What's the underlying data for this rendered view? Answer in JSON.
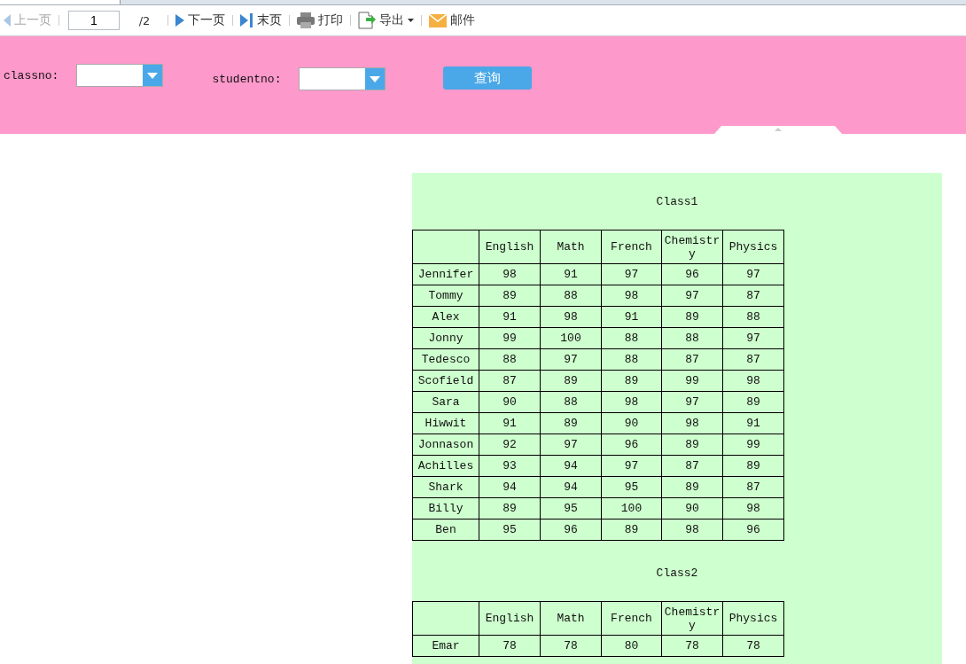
{
  "toolbar": {
    "prev": {
      "label": "上一页",
      "disabled": true
    },
    "page": {
      "value": "1",
      "total": "/2"
    },
    "next": {
      "label": "下一页",
      "disabled": false
    },
    "last": {
      "label": "末页",
      "disabled": false
    },
    "print": "打印",
    "export": "导出",
    "mail": "邮件"
  },
  "filters": [
    {
      "label": "classno:"
    },
    {
      "label": "studentno:"
    }
  ],
  "query_button": "查询",
  "tables": [
    {
      "title": "Class1",
      "columns": [
        "English",
        "Math",
        "French",
        "Chemistry",
        "Physics"
      ],
      "rows": [
        {
          "name": "Jennifer",
          "scores": [
            "98",
            "91",
            "97",
            "96",
            "97"
          ]
        },
        {
          "name": "Tommy",
          "scores": [
            "89",
            "88",
            "98",
            "97",
            "87"
          ]
        },
        {
          "name": "Alex",
          "scores": [
            "91",
            "98",
            "91",
            "89",
            "88"
          ]
        },
        {
          "name": "Jonny",
          "scores": [
            "99",
            "100",
            "88",
            "88",
            "97"
          ]
        },
        {
          "name": "Tedesco",
          "scores": [
            "88",
            "97",
            "88",
            "87",
            "87"
          ]
        },
        {
          "name": "Scofield",
          "scores": [
            "87",
            "89",
            "89",
            "99",
            "98"
          ]
        },
        {
          "name": "Sara",
          "scores": [
            "90",
            "88",
            "98",
            "97",
            "89"
          ]
        },
        {
          "name": "Hiwwit",
          "scores": [
            "91",
            "89",
            "90",
            "98",
            "91"
          ]
        },
        {
          "name": "Jonnason",
          "scores": [
            "92",
            "97",
            "96",
            "89",
            "99"
          ]
        },
        {
          "name": "Achilles",
          "scores": [
            "93",
            "94",
            "97",
            "87",
            "89"
          ]
        },
        {
          "name": "Shark",
          "scores": [
            "94",
            "94",
            "95",
            "89",
            "87"
          ]
        },
        {
          "name": "Billy",
          "scores": [
            "89",
            "95",
            "100",
            "90",
            "98"
          ]
        },
        {
          "name": "Ben",
          "scores": [
            "95",
            "96",
            "89",
            "98",
            "96"
          ]
        }
      ]
    },
    {
      "title": "Class2",
      "columns": [
        "English",
        "Math",
        "French",
        "Chemistry",
        "Physics"
      ],
      "rows": [
        {
          "name": "Emar",
          "scores": [
            "78",
            "78",
            "80",
            "78",
            "78"
          ]
        }
      ]
    }
  ]
}
